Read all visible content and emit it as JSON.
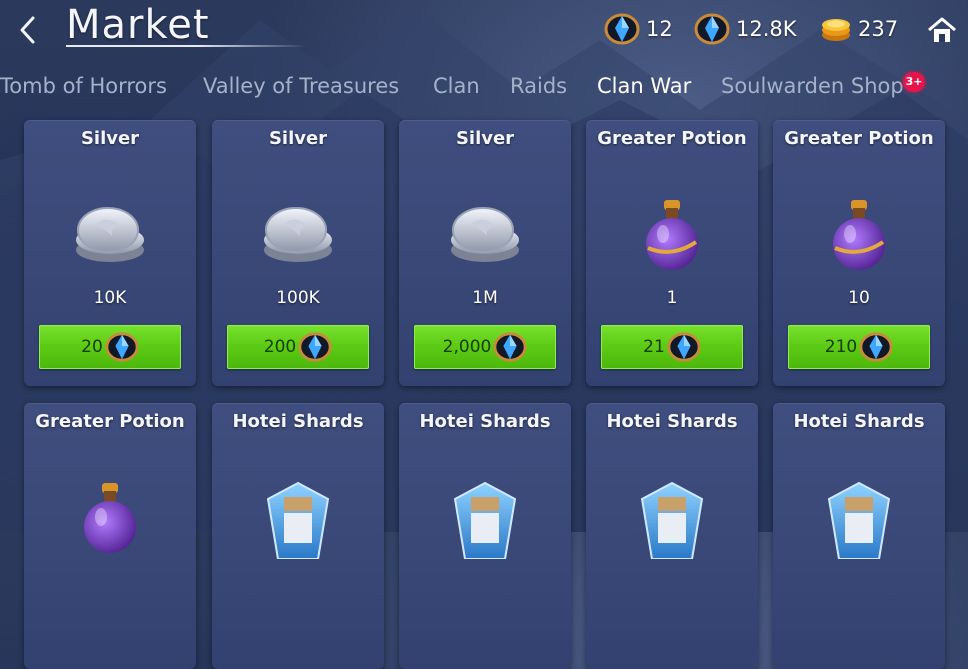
{
  "header": {
    "title": "Market"
  },
  "currencies": [
    {
      "name": "gem-small",
      "value": "12"
    },
    {
      "name": "gem",
      "value": "12.8K"
    },
    {
      "name": "gold",
      "value": "237"
    }
  ],
  "tabs": [
    {
      "label": "Tomb of Horrors",
      "active": false
    },
    {
      "label": "Valley of Treasures",
      "active": false
    },
    {
      "label": "Clan",
      "active": false
    },
    {
      "label": "Raids",
      "active": false
    },
    {
      "label": "Clan War",
      "active": true
    },
    {
      "label": "Soulwarden Shop",
      "active": false,
      "badge": "3+"
    }
  ],
  "items": [
    {
      "name": "Silver",
      "icon": "silver-coins-icon",
      "qty": "10K",
      "price": "20"
    },
    {
      "name": "Silver",
      "icon": "silver-coins-icon",
      "qty": "100K",
      "price": "200"
    },
    {
      "name": "Silver",
      "icon": "silver-coins-icon",
      "qty": "1M",
      "price": "2,000"
    },
    {
      "name": "Greater Potion",
      "icon": "potion-icon",
      "qty": "1",
      "price": "21"
    },
    {
      "name": "Greater Potion",
      "icon": "potion-icon",
      "qty": "10",
      "price": "210"
    },
    {
      "name": "Greater Potion",
      "icon": "potion-icon",
      "qty": "",
      "price": ""
    },
    {
      "name": "Hotei Shards",
      "icon": "hotei-shard-icon",
      "qty": "",
      "price": ""
    },
    {
      "name": "Hotei Shards",
      "icon": "hotei-shard-icon",
      "qty": "",
      "price": ""
    },
    {
      "name": "Hotei Shards",
      "icon": "hotei-shard-icon",
      "qty": "",
      "price": ""
    },
    {
      "name": "Hotei Shards",
      "icon": "hotei-shard-icon",
      "qty": "",
      "price": ""
    }
  ],
  "colors": {
    "buy_button": "#5ecc16",
    "badge": "#e5154c",
    "card": "#3a4878"
  }
}
